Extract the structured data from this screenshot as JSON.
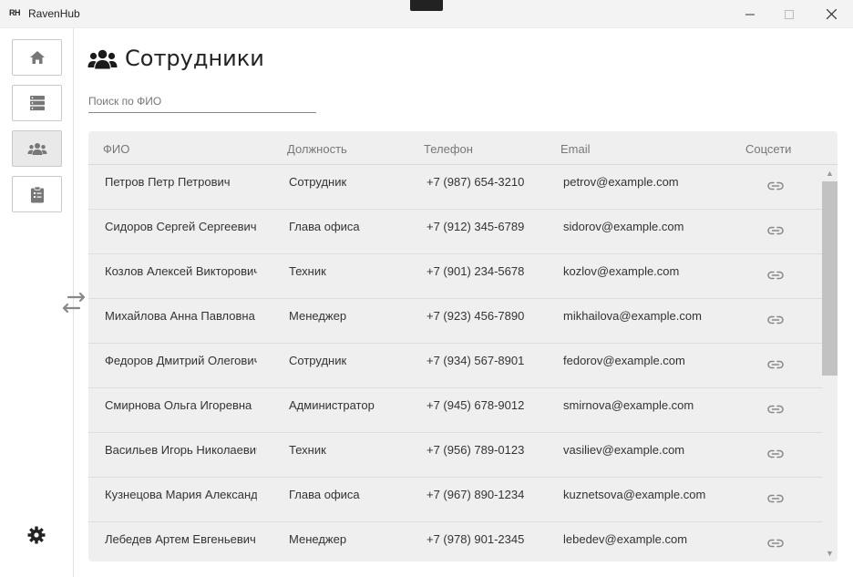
{
  "window": {
    "logo": "RH",
    "title": "RavenHub"
  },
  "sidebar": {
    "items": [
      {
        "icon": "home-icon"
      },
      {
        "icon": "server-icon"
      },
      {
        "icon": "users-icon"
      },
      {
        "icon": "clipboard-icon"
      }
    ],
    "active_index": 2,
    "settings_icon": "gear-icon"
  },
  "page": {
    "title": "Сотрудники",
    "title_icon": "users-icon"
  },
  "search": {
    "placeholder": "Поиск по ФИО",
    "value": ""
  },
  "table": {
    "headers": {
      "name": "ФИО",
      "position": "Должность",
      "phone": "Телефон",
      "email": "Email",
      "social": "Соцсети"
    },
    "rows": [
      {
        "name": "Петров Петр Петрович",
        "position": "Сотрудник",
        "phone": "+7 (987) 654-3210",
        "email": "petrov@example.com"
      },
      {
        "name": "Сидоров Сергей Сергеевич",
        "position": "Глава офиса",
        "phone": "+7 (912) 345-6789",
        "email": "sidorov@example.com"
      },
      {
        "name": "Козлов Алексей Викторович",
        "position": "Техник",
        "phone": "+7 (901) 234-5678",
        "email": "kozlov@example.com"
      },
      {
        "name": "Михайлова Анна Павловна",
        "position": "Менеджер",
        "phone": "+7 (923) 456-7890",
        "email": "mikhailova@example.com"
      },
      {
        "name": "Федоров Дмитрий Олегович",
        "position": "Сотрудник",
        "phone": "+7 (934) 567-8901",
        "email": "fedorov@example.com"
      },
      {
        "name": "Смирнова Ольга Игоревна",
        "position": "Администратор",
        "phone": "+7 (945) 678-9012",
        "email": "smirnova@example.com"
      },
      {
        "name": "Васильев Игорь Николаевич",
        "position": "Техник",
        "phone": "+7 (956) 789-0123",
        "email": "vasiliev@example.com"
      },
      {
        "name": "Кузнецова Мария Александровна",
        "position": "Глава офиса",
        "phone": "+7 (967) 890-1234",
        "email": "kuznetsova@example.com"
      },
      {
        "name": "Лебедев Артем Евгеньевич",
        "position": "Менеджер",
        "phone": "+7 (978) 901-2345",
        "email": "lebedev@example.com"
      }
    ]
  },
  "colors": {
    "table_bg": "#efefef",
    "accent_icon": "#333333",
    "scroll_thumb": "#c2c2c2"
  }
}
